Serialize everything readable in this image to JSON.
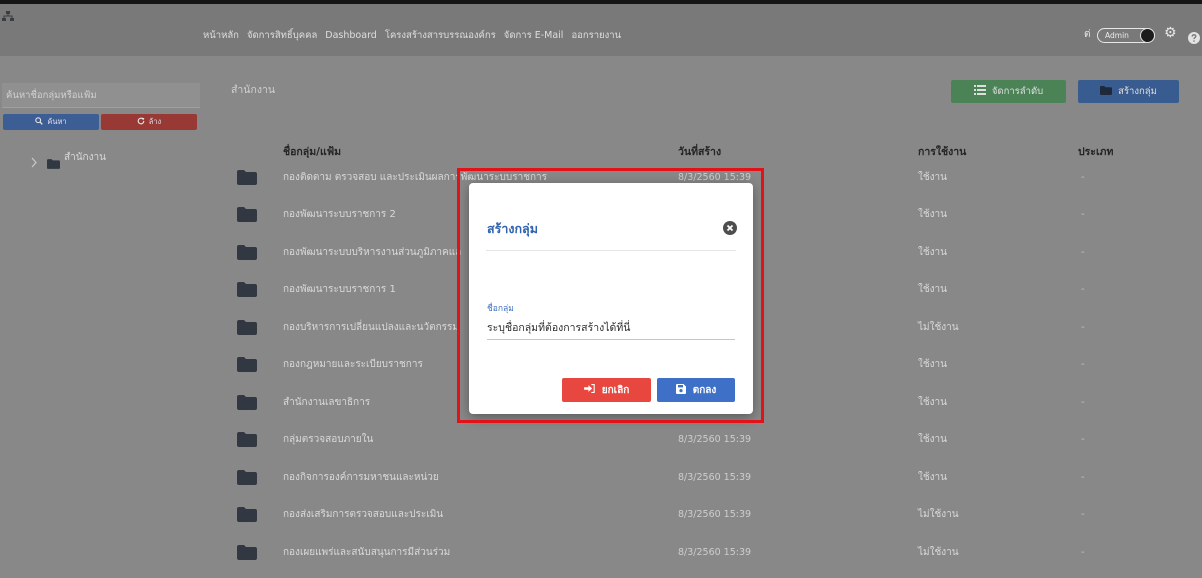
{
  "nav": {
    "logo_icon": "org-tree-icon",
    "links": [
      "หน้าหลัก",
      "จัดการสิทธิ์บุคคล",
      "Dashboard",
      "โครงสร้างสารบรรณองค์กร",
      "จัดการ E-Mail",
      "ออกรายงาน"
    ],
    "user_name": "ต่",
    "role_toggle_label": "Admin",
    "role_toggle_on": true,
    "settings_icon": "cogs-icon",
    "help_icon": "question-circle-icon"
  },
  "sidebar": {
    "search_placeholder": "ค้นหาชื่อกลุ่มหรือแฟ้ม",
    "search_value": "",
    "search_button": {
      "label": "ค้นหา",
      "icon": "search-icon"
    },
    "clear_button": {
      "label": "ล้าง",
      "icon": "refresh-icon"
    },
    "tree": [
      {
        "label": "สำนักงาน",
        "icon": "folder-icon",
        "expanded": false
      }
    ]
  },
  "main": {
    "title": "สำนักงาน",
    "reorder_button": {
      "label": "จัดการลำดับ",
      "icon": "list-icon"
    },
    "create_group_button": {
      "label": "สร้างกลุ่ม",
      "icon": "folder-icon"
    },
    "columns": {
      "name": "ชื่อกลุ่ม/แฟ้ม",
      "created": "วันที่สร้าง",
      "status": "การใช้งาน",
      "type": "ประเภท"
    },
    "rows": [
      {
        "name": "กองติดตาม ตรวจสอบ และประเมินผลการพัฒนาระบบราชการ",
        "created": "8/3/2560 15:39",
        "status": "ใช้งาน",
        "type": "-"
      },
      {
        "name": "กองพัฒนาระบบราชการ 2",
        "created": "",
        "status": "ใช้งาน",
        "type": "-"
      },
      {
        "name": "กองพัฒนาระบบบริหารงานส่วนภูมิภาคแล",
        "created": "",
        "status": "ใช้งาน",
        "type": "-"
      },
      {
        "name": "กองพัฒนาระบบราชการ 1",
        "created": "",
        "status": "ใช้งาน",
        "type": "-"
      },
      {
        "name": "กองบริหารการเปลี่ยนแปลงและนวัตกรรม",
        "created": "",
        "status": "ไม่ใช้งาน",
        "type": "-"
      },
      {
        "name": "กองกฎหมายและระเบียบราชการ",
        "created": "",
        "status": "ใช้งาน",
        "type": "-"
      },
      {
        "name": "สำนักงานเลขาธิการ",
        "created": "",
        "status": "ใช้งาน",
        "type": "-"
      },
      {
        "name": "กลุ่มตรวจสอบภายใน",
        "created": "8/3/2560 15:39",
        "status": "ใช้งาน",
        "type": "-"
      },
      {
        "name": "กองกิจการองค์การมหาชนและหน่วย",
        "created": "8/3/2560 15:39",
        "status": "ใช้งาน",
        "type": "-"
      },
      {
        "name": "กองส่งเสริมการตรวจสอบและประเมิน",
        "created": "8/3/2560 15:39",
        "status": "ไม่ใช้งาน",
        "type": "-"
      },
      {
        "name": "กองเผยแพร่และสนับสนุนการมีส่วนร่วม",
        "created": "8/3/2560 15:39",
        "status": "ไม่ใช้งาน",
        "type": "-"
      }
    ]
  },
  "modal": {
    "title": "สร้างกลุ่ม",
    "close_icon": "times-circle-icon",
    "field_label": "ชื่อกลุ่ม",
    "field_placeholder": "ระบุชื่อกลุ่มที่ต้องการสร้างได้ที่นี่",
    "field_value": "",
    "cancel_button": {
      "label": "ยกเลิก",
      "icon": "sign-out-icon"
    },
    "ok_button": {
      "label": "ตกลง",
      "icon": "save-icon"
    }
  },
  "colors": {
    "modal-title": "#2f63ae",
    "cancel": "#e8473f",
    "ok": "#3d70c6",
    "highlight": "#e3121a",
    "btn-green": "#4d8659",
    "btn-blue": "#3b5e93"
  }
}
